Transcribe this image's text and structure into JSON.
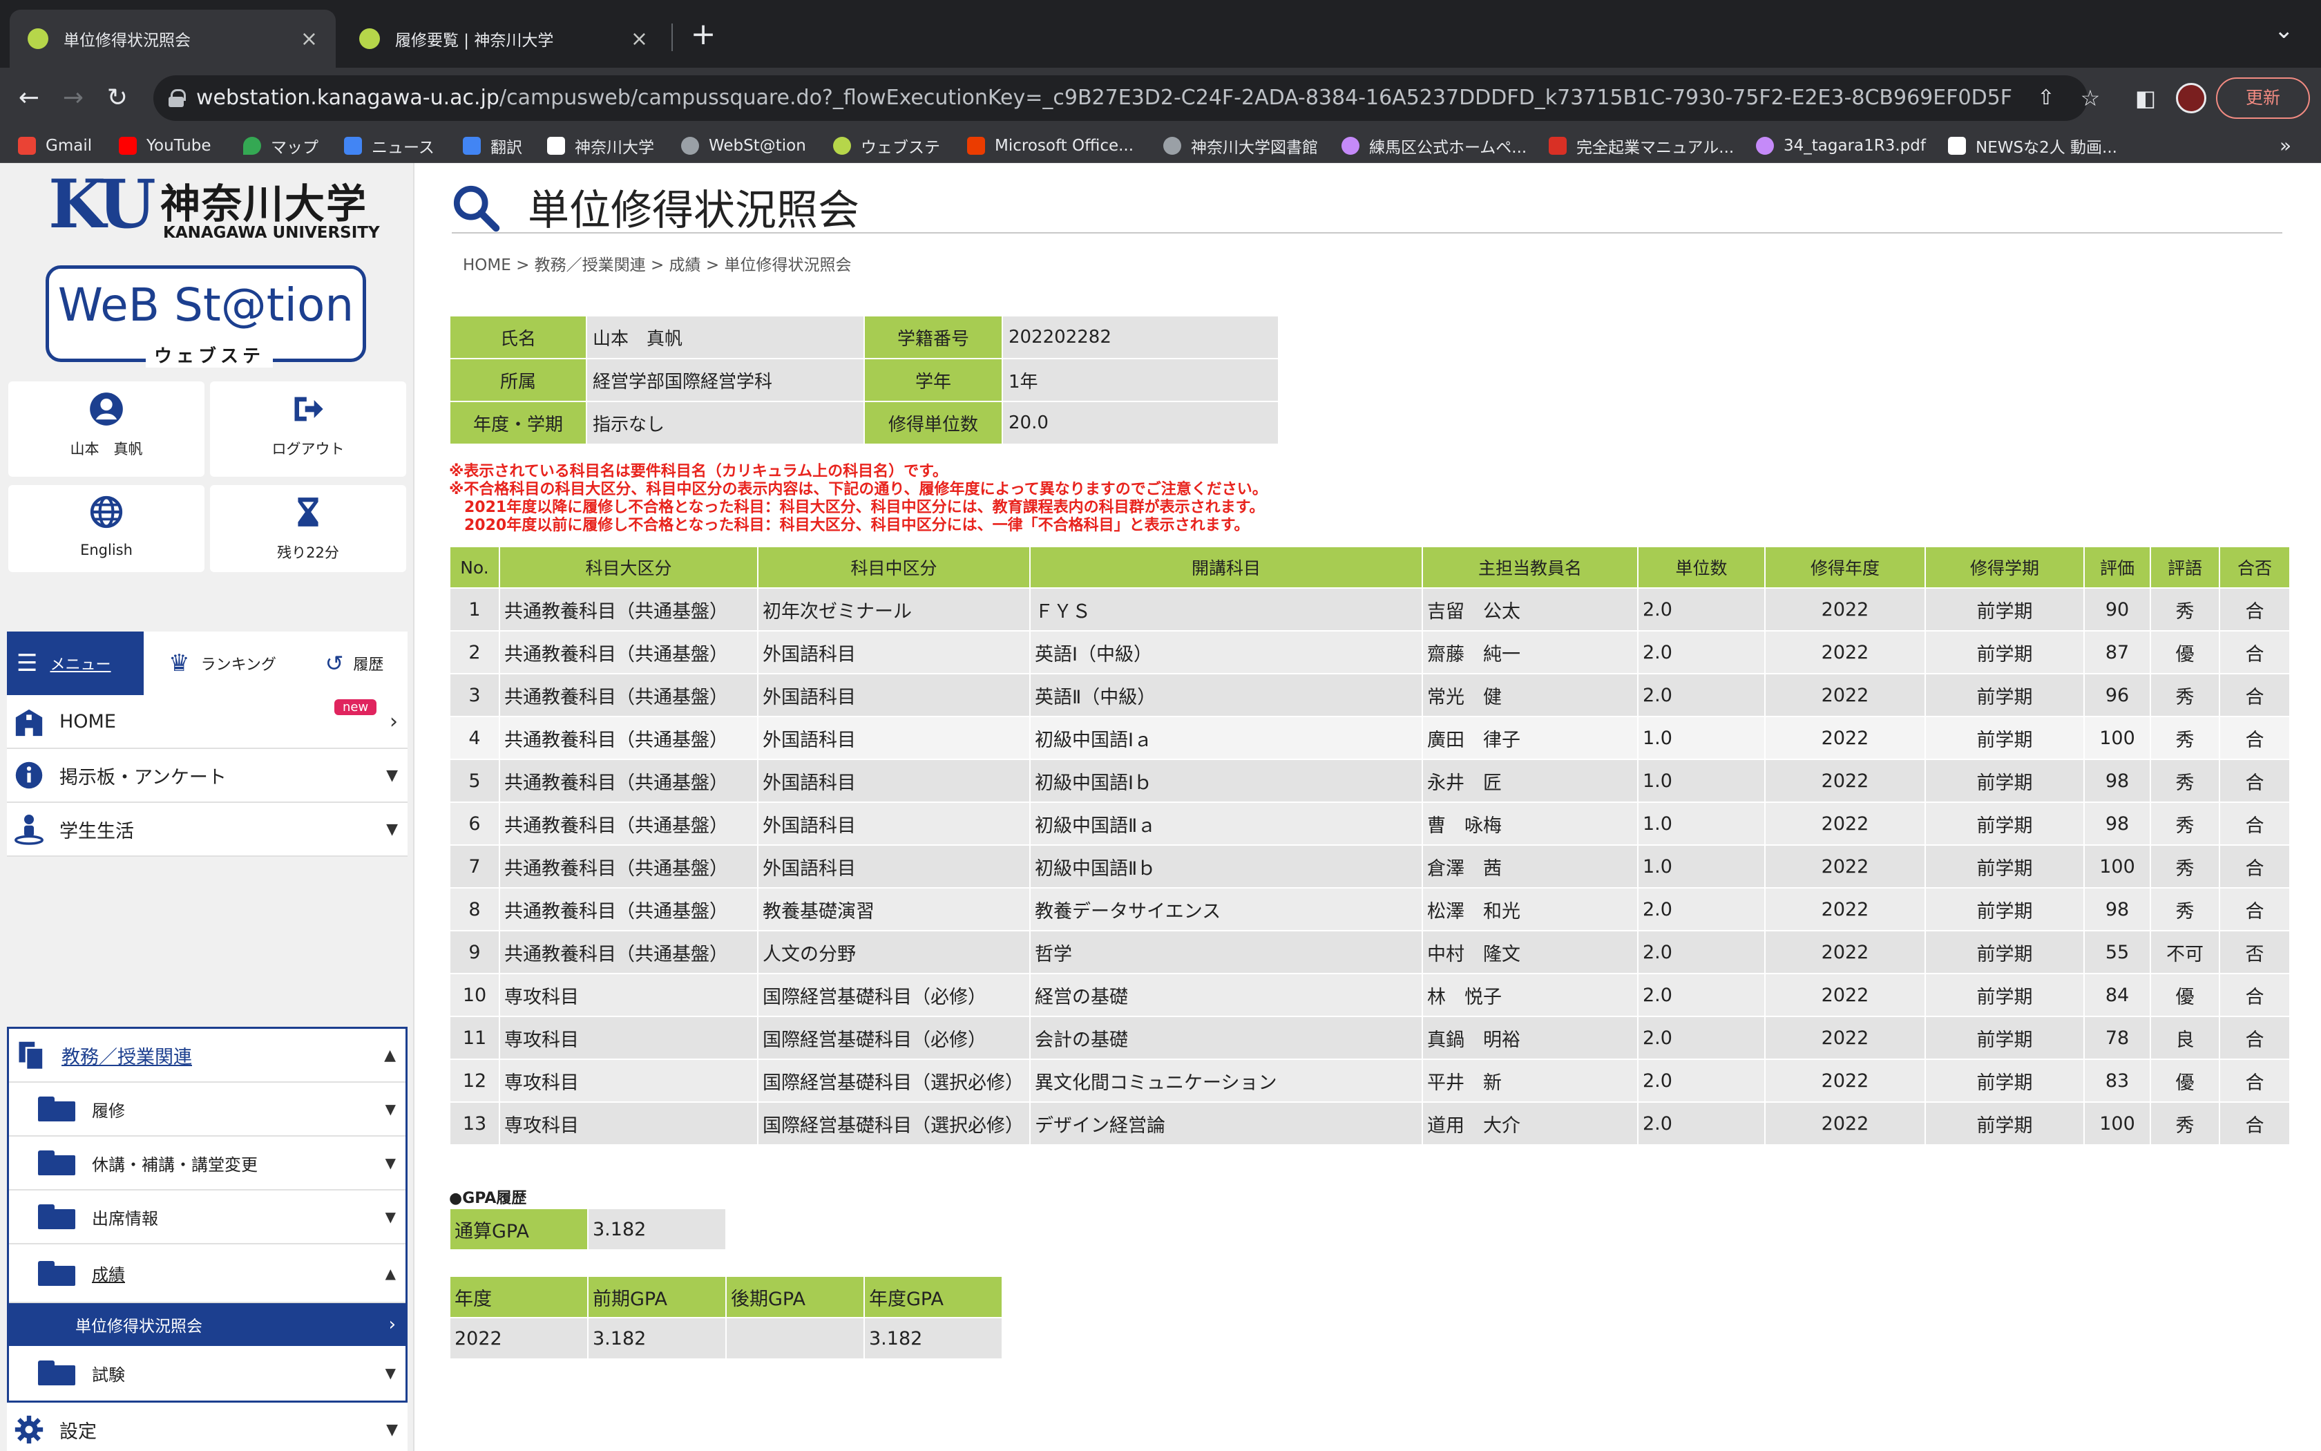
{
  "browser": {
    "tabs": [
      {
        "title": "単位修得状況照会",
        "active": true
      },
      {
        "title": "履修要覧 | 神奈川大学",
        "active": false
      }
    ],
    "url_host": "webstation.kanagawa-u.ac.jp",
    "url_path": "/campusweb/campussquare.do?_flowExecutionKey=_c9B27E3D2-C24F-2ADA-8384-16A5237DDDFD_k73715B1C-7930-75F2-E2E3-8CB969EF0D5F",
    "update_label": "更新",
    "bookmarks": [
      {
        "label": "Gmail",
        "color": "#ea4335"
      },
      {
        "label": "YouTube",
        "color": "#ff0000"
      },
      {
        "label": "マップ",
        "color": "#34a853"
      },
      {
        "label": "ニュース",
        "color": "#4285f4"
      },
      {
        "label": "翻訳",
        "color": "#4285f4"
      },
      {
        "label": "神奈川大学",
        "color": "#ffffff"
      },
      {
        "label": "WebSt@tion",
        "color": "#9aa0a6"
      },
      {
        "label": "ウェブステ",
        "color": "#b6d64a"
      },
      {
        "label": "Microsoft Office...",
        "color": "#eb3c00"
      },
      {
        "label": "神奈川大学図書館",
        "color": "#9aa0a6"
      },
      {
        "label": "練馬区公式ホームペ...",
        "color": "#c58af9"
      },
      {
        "label": "完全起業マニュアル...",
        "color": "#d93025"
      },
      {
        "label": "34_tagara1R3.pdf",
        "color": "#c58af9"
      },
      {
        "label": "NEWSな2人 動画...",
        "color": "#ffffff"
      }
    ]
  },
  "sidebar": {
    "logo": {
      "ku": "KU",
      "jp": "神奈川大学",
      "en": "KANAGAWA UNIVERSITY"
    },
    "webstation": {
      "title": "WeB St@tion",
      "sub": "ウェブステ"
    },
    "user_name": "山本　真帆",
    "logout_label": "ログアウト",
    "english_label": "English",
    "remaining_label": "残り22分",
    "tabs": {
      "menu": "メニュー",
      "ranking": "ランキング",
      "history": "履歴"
    },
    "nav": {
      "home": "HOME",
      "home_badge": "new",
      "board": "掲示板・アンケート",
      "life": "学生生活",
      "edu": "教務／授業関連",
      "sub_rishu": "履修",
      "sub_kyuko": "休講・補講・講堂変更",
      "sub_shusseki": "出席情報",
      "sub_seiseki": "成績",
      "sub_current": "単位修得状況照会",
      "sub_shiken": "試験",
      "settings": "設定"
    }
  },
  "main": {
    "title": "単位修得状況照会",
    "breadcrumb": "HOME > 教務／授業関連 > 成績 > 単位修得状況照会",
    "info": {
      "name_label": "氏名",
      "name": "山本　真帆",
      "id_label": "学籍番号",
      "id": "202202282",
      "dept_label": "所属",
      "dept": "経営学部国際経営学科",
      "year_label": "学年",
      "year": "1年",
      "term_label": "年度・学期",
      "term": "指示なし",
      "credits_label": "修得単位数",
      "credits": "20.0"
    },
    "notes": [
      "※表示されている科目名は要件科目名（カリキュラム上の科目名）です。",
      "※不合格科目の科目大区分、科目中区分の表示内容は、下記の通り、履修年度によって異なりますのでご注意ください。",
      "　2021年度以降に履修し不合格となった科目：科目大区分、科目中区分には、教育課程表内の科目群が表示されます。",
      "　2020年度以前に履修し不合格となった科目：科目大区分、科目中区分には、一律「不合格科目」と表示されます。"
    ],
    "grade_headers": [
      "No.",
      "科目大区分",
      "科目中区分",
      "開講科目",
      "主担当教員名",
      "単位数",
      "修得年度",
      "修得学期",
      "評価",
      "評語",
      "合否"
    ],
    "grades": [
      [
        "1",
        "共通教養科目（共通基盤）",
        "初年次ゼミナール",
        "ＦＹＳ",
        "吉留　公太",
        "2.0",
        "2022",
        "前学期",
        "90",
        "秀",
        "合"
      ],
      [
        "2",
        "共通教養科目（共通基盤）",
        "外国語科目",
        "英語Ⅰ（中級）",
        "齋藤　純一",
        "2.0",
        "2022",
        "前学期",
        "87",
        "優",
        "合"
      ],
      [
        "3",
        "共通教養科目（共通基盤）",
        "外国語科目",
        "英語Ⅱ（中級）",
        "常光　健",
        "2.0",
        "2022",
        "前学期",
        "96",
        "秀",
        "合"
      ],
      [
        "4",
        "共通教養科目（共通基盤）",
        "外国語科目",
        "初級中国語Ⅰａ",
        "廣田　律子",
        "1.0",
        "2022",
        "前学期",
        "100",
        "秀",
        "合"
      ],
      [
        "5",
        "共通教養科目（共通基盤）",
        "外国語科目",
        "初級中国語Ⅰｂ",
        "永井　匠",
        "1.0",
        "2022",
        "前学期",
        "98",
        "秀",
        "合"
      ],
      [
        "6",
        "共通教養科目（共通基盤）",
        "外国語科目",
        "初級中国語Ⅱａ",
        "曹　咏梅",
        "1.0",
        "2022",
        "前学期",
        "98",
        "秀",
        "合"
      ],
      [
        "7",
        "共通教養科目（共通基盤）",
        "外国語科目",
        "初級中国語Ⅱｂ",
        "倉澤　茜",
        "1.0",
        "2022",
        "前学期",
        "100",
        "秀",
        "合"
      ],
      [
        "8",
        "共通教養科目（共通基盤）",
        "教養基礎演習",
        "教養データサイエンス",
        "松澤　和光",
        "2.0",
        "2022",
        "前学期",
        "98",
        "秀",
        "合"
      ],
      [
        "9",
        "共通教養科目（共通基盤）",
        "人文の分野",
        "哲学",
        "中村　隆文",
        "2.0",
        "2022",
        "前学期",
        "55",
        "不可",
        "否"
      ],
      [
        "10",
        "専攻科目",
        "国際経営基礎科目（必修）",
        "経営の基礎",
        "林　悦子",
        "2.0",
        "2022",
        "前学期",
        "84",
        "優",
        "合"
      ],
      [
        "11",
        "専攻科目",
        "国際経営基礎科目（必修）",
        "会計の基礎",
        "真鍋　明裕",
        "2.0",
        "2022",
        "前学期",
        "78",
        "良",
        "合"
      ],
      [
        "12",
        "専攻科目",
        "国際経営基礎科目（選択必修）",
        "異文化間コミュニケーション",
        "平井　新",
        "2.0",
        "2022",
        "前学期",
        "83",
        "優",
        "合"
      ],
      [
        "13",
        "専攻科目",
        "国際経営基礎科目（選択必修）",
        "デザイン経営論",
        "道用　大介",
        "2.0",
        "2022",
        "前学期",
        "100",
        "秀",
        "合"
      ]
    ],
    "gpa": {
      "heading": "●GPA履歴",
      "total_label": "通算GPA",
      "total": "3.182",
      "headers": [
        "年度",
        "前期GPA",
        "後期GPA",
        "年度GPA"
      ],
      "rows": [
        [
          "2022",
          "3.182",
          "",
          "3.182"
        ]
      ]
    }
  }
}
